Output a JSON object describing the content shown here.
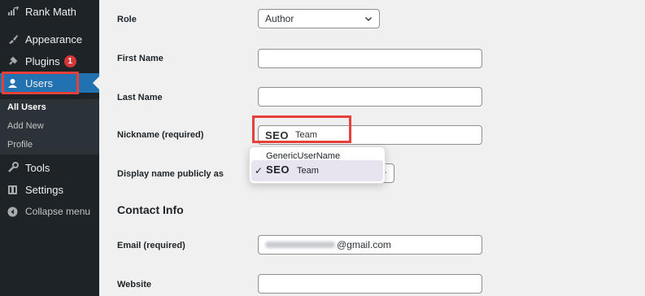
{
  "sidebar": {
    "items": [
      {
        "label": "Rank Math",
        "icon": "rank-math-icon"
      },
      {
        "label": "Appearance",
        "icon": "brush-icon"
      },
      {
        "label": "Plugins",
        "icon": "plug-icon",
        "badge": "1"
      },
      {
        "label": "Users",
        "icon": "user-icon"
      },
      {
        "label": "Tools",
        "icon": "wrench-icon"
      },
      {
        "label": "Settings",
        "icon": "settings-icon"
      },
      {
        "label": "Collapse menu",
        "icon": "collapse-icon"
      }
    ],
    "submenu": [
      "All Users",
      "Add New",
      "Profile"
    ]
  },
  "form": {
    "role": {
      "label": "Role",
      "value": "Author"
    },
    "first_name": {
      "label": "First Name",
      "value": ""
    },
    "last_name": {
      "label": "Last Name",
      "value": ""
    },
    "nickname": {
      "label": "Nickname (required)",
      "value_part1": "SEO",
      "value_part2": "Team"
    },
    "display_name": {
      "label": "Display name publicly as",
      "options": [
        "GenericUserName",
        "SEO",
        "Team"
      ],
      "checkmark": "✓"
    },
    "contact_title": "Contact Info",
    "email": {
      "label": "Email (required)",
      "value_suffix": "@gmail.com"
    },
    "website": {
      "label": "Website",
      "value": ""
    }
  },
  "colors": {
    "accent": "#2271b1",
    "highlight": "#e5403a",
    "badge": "#d63638",
    "sidebar": "#1d2327"
  }
}
